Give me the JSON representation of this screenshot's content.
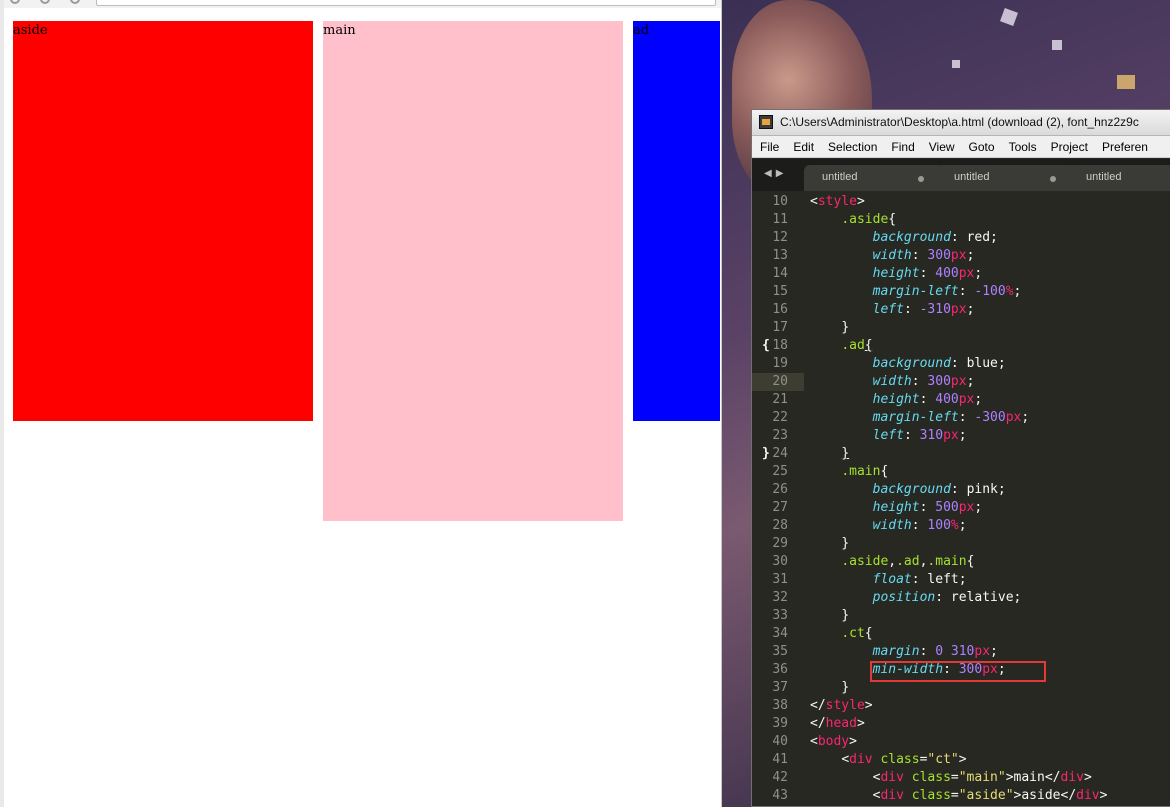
{
  "browser": {
    "boxes": [
      {
        "label": "aside",
        "color": "#ff0000"
      },
      {
        "label": "main",
        "color": "#ffc0cb"
      },
      {
        "label": "ad",
        "color": "#0000ff"
      }
    ]
  },
  "editor": {
    "window_title": "C:\\Users\\Administrator\\Desktop\\a.html (download (2), font_hnz2z9c",
    "menu": [
      "File",
      "Edit",
      "Selection",
      "Find",
      "View",
      "Goto",
      "Tools",
      "Project",
      "Preferen"
    ],
    "tabs": [
      {
        "label": "untitled",
        "dirty": true
      },
      {
        "label": "untitled",
        "dirty": true
      },
      {
        "label": "untitled",
        "dirty": false
      }
    ],
    "current_line": 20,
    "highlighted_line": 36,
    "lines": [
      {
        "n": 10,
        "indent": 0,
        "tokens": [
          [
            "t-p",
            "<"
          ],
          [
            "t-tag",
            "style"
          ],
          [
            "t-p",
            ">"
          ]
        ]
      },
      {
        "n": 11,
        "indent": 1,
        "tokens": [
          [
            "t-sel",
            ".aside"
          ],
          [
            "t-p",
            "{"
          ]
        ]
      },
      {
        "n": 12,
        "indent": 2,
        "tokens": [
          [
            "t-prop",
            "background"
          ],
          [
            "t-p",
            ": "
          ],
          [
            "t-val",
            "red"
          ],
          [
            "t-p",
            ";"
          ]
        ]
      },
      {
        "n": 13,
        "indent": 2,
        "tokens": [
          [
            "t-prop",
            "width"
          ],
          [
            "t-p",
            ": "
          ],
          [
            "t-num",
            "300"
          ],
          [
            "t-unit",
            "px"
          ],
          [
            "t-p",
            ";"
          ]
        ]
      },
      {
        "n": 14,
        "indent": 2,
        "tokens": [
          [
            "t-prop",
            "height"
          ],
          [
            "t-p",
            ": "
          ],
          [
            "t-num",
            "400"
          ],
          [
            "t-unit",
            "px"
          ],
          [
            "t-p",
            ";"
          ]
        ]
      },
      {
        "n": 15,
        "indent": 2,
        "tokens": [
          [
            "t-prop",
            "margin-left"
          ],
          [
            "t-p",
            ": "
          ],
          [
            "t-num",
            "-100"
          ],
          [
            "t-unit",
            "%"
          ],
          [
            "t-p",
            ";"
          ]
        ]
      },
      {
        "n": 16,
        "indent": 2,
        "tokens": [
          [
            "t-prop",
            "left"
          ],
          [
            "t-p",
            ": "
          ],
          [
            "t-num",
            "-310"
          ],
          [
            "t-unit",
            "px"
          ],
          [
            "t-p",
            ";"
          ]
        ]
      },
      {
        "n": 17,
        "indent": 1,
        "tokens": [
          [
            "t-p",
            "}"
          ]
        ]
      },
      {
        "n": 18,
        "indent": 1,
        "fold": "{",
        "tokens": [
          [
            "t-sel",
            ".ad"
          ],
          [
            "t-p ul",
            "{"
          ]
        ]
      },
      {
        "n": 19,
        "indent": 2,
        "tokens": [
          [
            "t-prop",
            "background"
          ],
          [
            "t-p",
            ": "
          ],
          [
            "t-val",
            "blue"
          ],
          [
            "t-p",
            ";"
          ]
        ]
      },
      {
        "n": 20,
        "indent": 2,
        "tokens": [
          [
            "t-prop",
            "width"
          ],
          [
            "t-p",
            ": "
          ],
          [
            "t-num",
            "300"
          ],
          [
            "t-unit",
            "px"
          ],
          [
            "t-p",
            ";"
          ]
        ]
      },
      {
        "n": 21,
        "indent": 2,
        "tokens": [
          [
            "t-prop",
            "height"
          ],
          [
            "t-p",
            ": "
          ],
          [
            "t-num",
            "400"
          ],
          [
            "t-unit",
            "px"
          ],
          [
            "t-p",
            ";"
          ]
        ]
      },
      {
        "n": 22,
        "indent": 2,
        "tokens": [
          [
            "t-prop",
            "margin-left"
          ],
          [
            "t-p",
            ": "
          ],
          [
            "t-num",
            "-300"
          ],
          [
            "t-unit",
            "px"
          ],
          [
            "t-p",
            ";"
          ]
        ]
      },
      {
        "n": 23,
        "indent": 2,
        "tokens": [
          [
            "t-prop",
            "left"
          ],
          [
            "t-p",
            ": "
          ],
          [
            "t-num",
            "310"
          ],
          [
            "t-unit",
            "px"
          ],
          [
            "t-p",
            ";"
          ]
        ]
      },
      {
        "n": 24,
        "indent": 1,
        "fold": "}",
        "tokens": [
          [
            "t-p ul",
            "}"
          ]
        ]
      },
      {
        "n": 25,
        "indent": 1,
        "tokens": [
          [
            "t-sel",
            ".main"
          ],
          [
            "t-p",
            "{"
          ]
        ]
      },
      {
        "n": 26,
        "indent": 2,
        "tokens": [
          [
            "t-prop",
            "background"
          ],
          [
            "t-p",
            ": "
          ],
          [
            "t-val",
            "pink"
          ],
          [
            "t-p",
            ";"
          ]
        ]
      },
      {
        "n": 27,
        "indent": 2,
        "tokens": [
          [
            "t-prop",
            "height"
          ],
          [
            "t-p",
            ": "
          ],
          [
            "t-num",
            "500"
          ],
          [
            "t-unit",
            "px"
          ],
          [
            "t-p",
            ";"
          ]
        ]
      },
      {
        "n": 28,
        "indent": 2,
        "tokens": [
          [
            "t-prop",
            "width"
          ],
          [
            "t-p",
            ": "
          ],
          [
            "t-num",
            "100"
          ],
          [
            "t-unit",
            "%"
          ],
          [
            "t-p",
            ";"
          ]
        ]
      },
      {
        "n": 29,
        "indent": 1,
        "tokens": [
          [
            "t-p",
            "}"
          ]
        ]
      },
      {
        "n": 30,
        "indent": 1,
        "tokens": [
          [
            "t-sel",
            ".aside"
          ],
          [
            "t-p",
            ","
          ],
          [
            "t-sel",
            ".ad"
          ],
          [
            "t-p",
            ","
          ],
          [
            "t-sel",
            ".main"
          ],
          [
            "t-p",
            "{"
          ]
        ]
      },
      {
        "n": 31,
        "indent": 2,
        "tokens": [
          [
            "t-prop",
            "float"
          ],
          [
            "t-p",
            ": "
          ],
          [
            "t-val",
            "left"
          ],
          [
            "t-p",
            ";"
          ]
        ]
      },
      {
        "n": 32,
        "indent": 2,
        "tokens": [
          [
            "t-prop",
            "position"
          ],
          [
            "t-p",
            ": "
          ],
          [
            "t-val",
            "relative"
          ],
          [
            "t-p",
            ";"
          ]
        ]
      },
      {
        "n": 33,
        "indent": 1,
        "tokens": [
          [
            "t-p",
            "}"
          ]
        ]
      },
      {
        "n": 34,
        "indent": 1,
        "tokens": [
          [
            "t-sel",
            ".ct"
          ],
          [
            "t-p",
            "{"
          ]
        ]
      },
      {
        "n": 35,
        "indent": 2,
        "tokens": [
          [
            "t-prop",
            "margin"
          ],
          [
            "t-p",
            ": "
          ],
          [
            "t-num",
            "0"
          ],
          [
            "t-p",
            " "
          ],
          [
            "t-num",
            "310"
          ],
          [
            "t-unit",
            "px"
          ],
          [
            "t-p",
            ";"
          ]
        ]
      },
      {
        "n": 36,
        "indent": 2,
        "tokens": [
          [
            "t-prop",
            "min-width"
          ],
          [
            "t-p",
            ": "
          ],
          [
            "t-num",
            "300"
          ],
          [
            "t-unit",
            "px"
          ],
          [
            "t-p",
            ";"
          ]
        ]
      },
      {
        "n": 37,
        "indent": 1,
        "tokens": [
          [
            "t-p",
            "}"
          ]
        ]
      },
      {
        "n": 38,
        "indent": 0,
        "tokens": [
          [
            "t-p",
            "</"
          ],
          [
            "t-tag",
            "style"
          ],
          [
            "t-p",
            ">"
          ]
        ]
      },
      {
        "n": 39,
        "indent": 0,
        "tokens": [
          [
            "t-p",
            "</"
          ],
          [
            "t-tag",
            "head"
          ],
          [
            "t-p",
            ">"
          ]
        ]
      },
      {
        "n": 40,
        "indent": 0,
        "tokens": [
          [
            "t-p",
            "<"
          ],
          [
            "t-tag",
            "body"
          ],
          [
            "t-p",
            ">"
          ]
        ]
      },
      {
        "n": 41,
        "indent": 1,
        "tokens": [
          [
            "t-p",
            "<"
          ],
          [
            "t-tag",
            "div"
          ],
          [
            "t-p",
            " "
          ],
          [
            "t-attr",
            "class"
          ],
          [
            "t-p",
            "="
          ],
          [
            "t-str",
            "\"ct\""
          ],
          [
            "t-p",
            ">"
          ]
        ]
      },
      {
        "n": 42,
        "indent": 2,
        "tokens": [
          [
            "t-p",
            "<"
          ],
          [
            "t-tag",
            "div"
          ],
          [
            "t-p",
            " "
          ],
          [
            "t-attr",
            "class"
          ],
          [
            "t-p",
            "="
          ],
          [
            "t-str",
            "\"main\""
          ],
          [
            "t-p",
            ">main</"
          ],
          [
            "t-tag",
            "div"
          ],
          [
            "t-p",
            ">"
          ]
        ]
      },
      {
        "n": 43,
        "indent": 2,
        "tokens": [
          [
            "t-p",
            "<"
          ],
          [
            "t-tag",
            "div"
          ],
          [
            "t-p",
            " "
          ],
          [
            "t-attr",
            "class"
          ],
          [
            "t-p",
            "="
          ],
          [
            "t-str",
            "\"aside\""
          ],
          [
            "t-p",
            ">aside</"
          ],
          [
            "t-tag",
            "div"
          ],
          [
            "t-p",
            ">"
          ]
        ]
      }
    ]
  }
}
